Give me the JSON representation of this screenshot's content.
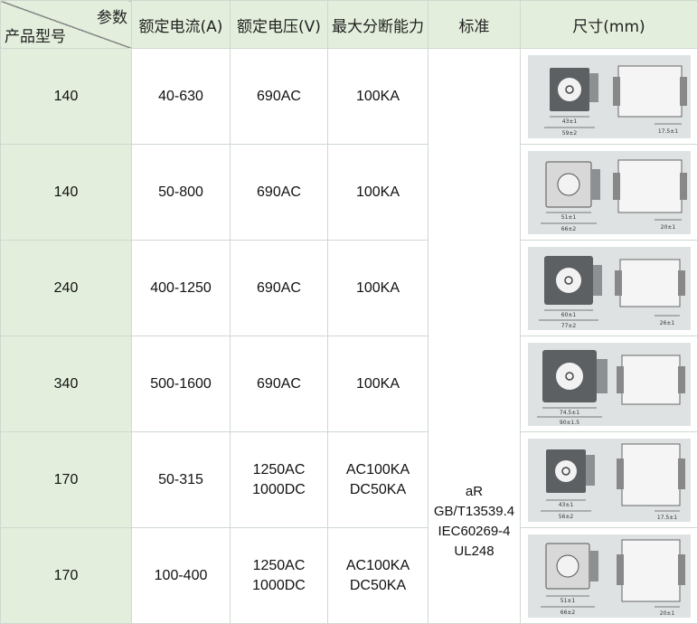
{
  "header": {
    "param_label": "参数",
    "model_label": "产品型号",
    "rated_current": "额定电流(A)",
    "rated_voltage": "额定电压(V)",
    "breaking_capacity": "最大分断能力",
    "standard": "标准",
    "dimensions": "尺寸(mm)"
  },
  "rows": [
    {
      "model": "140",
      "current": "40-630",
      "voltage": [
        "690AC"
      ],
      "breaking": [
        "100KA"
      ]
    },
    {
      "model": "140",
      "current": "50-800",
      "voltage": [
        "690AC"
      ],
      "breaking": [
        "100KA"
      ]
    },
    {
      "model": "240",
      "current": "400-1250",
      "voltage": [
        "690AC"
      ],
      "breaking": [
        "100KA"
      ]
    },
    {
      "model": "340",
      "current": "500-1600",
      "voltage": [
        "690AC"
      ],
      "breaking": [
        "100KA"
      ]
    },
    {
      "model": "170",
      "current": "50-315",
      "voltage": [
        "1250AC",
        "1000DC"
      ],
      "breaking": [
        "AC100KA",
        "DC50KA"
      ]
    },
    {
      "model": "170",
      "current": "100-400",
      "voltage": [
        "1250AC",
        "1000DC"
      ],
      "breaking": [
        "AC100KA",
        "DC50KA"
      ]
    }
  ],
  "standard_lines": [
    "aR",
    "GB/T13539.4",
    "IEC60269-4",
    "UL248"
  ],
  "drawings": [
    {
      "front_labels": [
        "43±1",
        "59±2"
      ],
      "side_label": "17.5±1"
    },
    {
      "front_labels": [
        "51±1",
        "66±2"
      ],
      "side_label": "20±1"
    },
    {
      "front_labels": [
        "60±1",
        "77±2"
      ],
      "side_label": "26±1"
    },
    {
      "front_labels": [
        "74.5±1",
        "90±1.5"
      ],
      "side_label": ""
    },
    {
      "front_labels": [
        "43±1",
        "56±2"
      ],
      "side_label": "17.5±1"
    },
    {
      "front_labels": [
        "51±1",
        "66±2"
      ],
      "side_label": "20±1"
    }
  ],
  "colors": {
    "header_bg": "#e3efdc",
    "model_bg": "#e3efdc",
    "border": "#cfd8cf",
    "drawing_bg": "#dfe2e3"
  }
}
